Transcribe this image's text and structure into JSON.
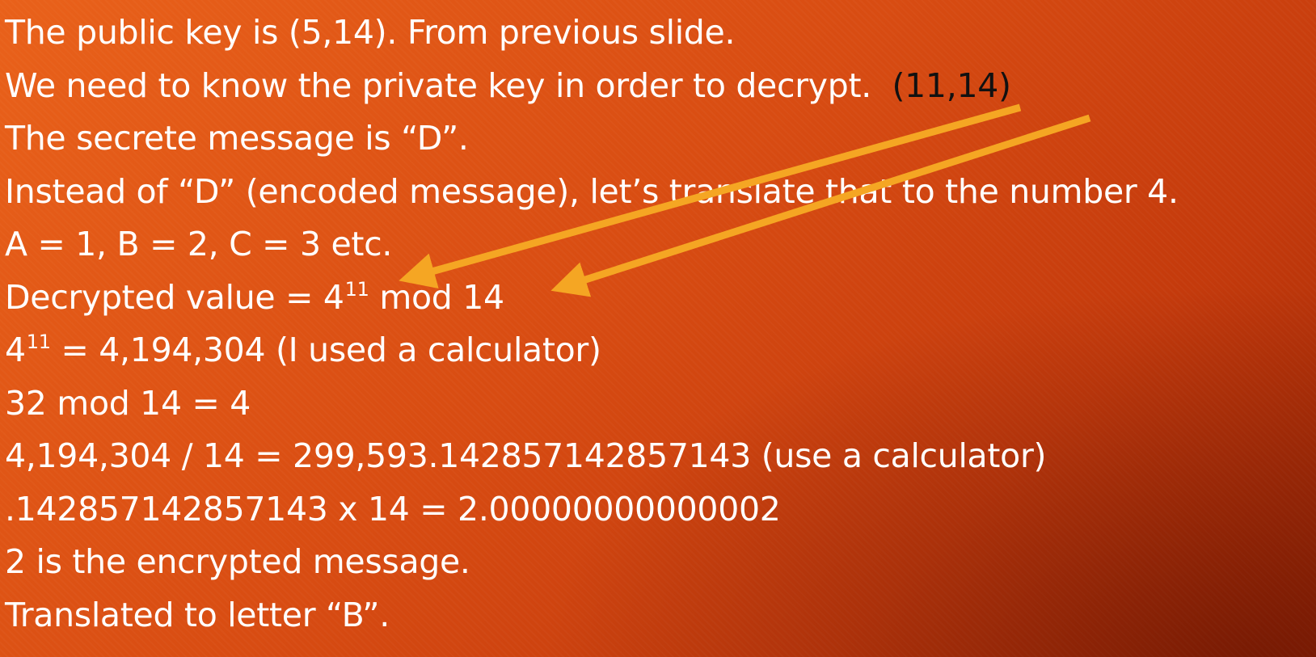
{
  "slide": {
    "line1": "The public key is (5,14). From previous slide.",
    "line2_text": "We need to know the private key in order to decrypt.",
    "private_key_label": "(11,14)",
    "line3": "The secrete message is “D”.",
    "line4": "Instead of “D” (encoded message), let’s translate that to the number 4.",
    "line5": "A = 1, B = 2, C = 3 etc.",
    "line6_prefix": "Decrypted value = 4",
    "line6_exponent": "11",
    "line6_suffix": " mod 14",
    "line7_base": "4",
    "line7_exponent": "11",
    "line7_suffix": " = 4,194,304 (I used a calculator)",
    "line8": "32 mod 14 = 4",
    "line9": "4,194,304 / 14 = 299,593.142857142857143  (use a calculator)",
    "line10": ".142857142857143 x 14 = 2.00000000000002",
    "line11": "2 is the encrypted message.",
    "line12": "Translated to letter “B”."
  },
  "colors": {
    "background_start": "#e9611a",
    "background_end": "#9e2604",
    "text": "#ffffff",
    "key_label": "#111111",
    "arrow": "#f5a623"
  }
}
